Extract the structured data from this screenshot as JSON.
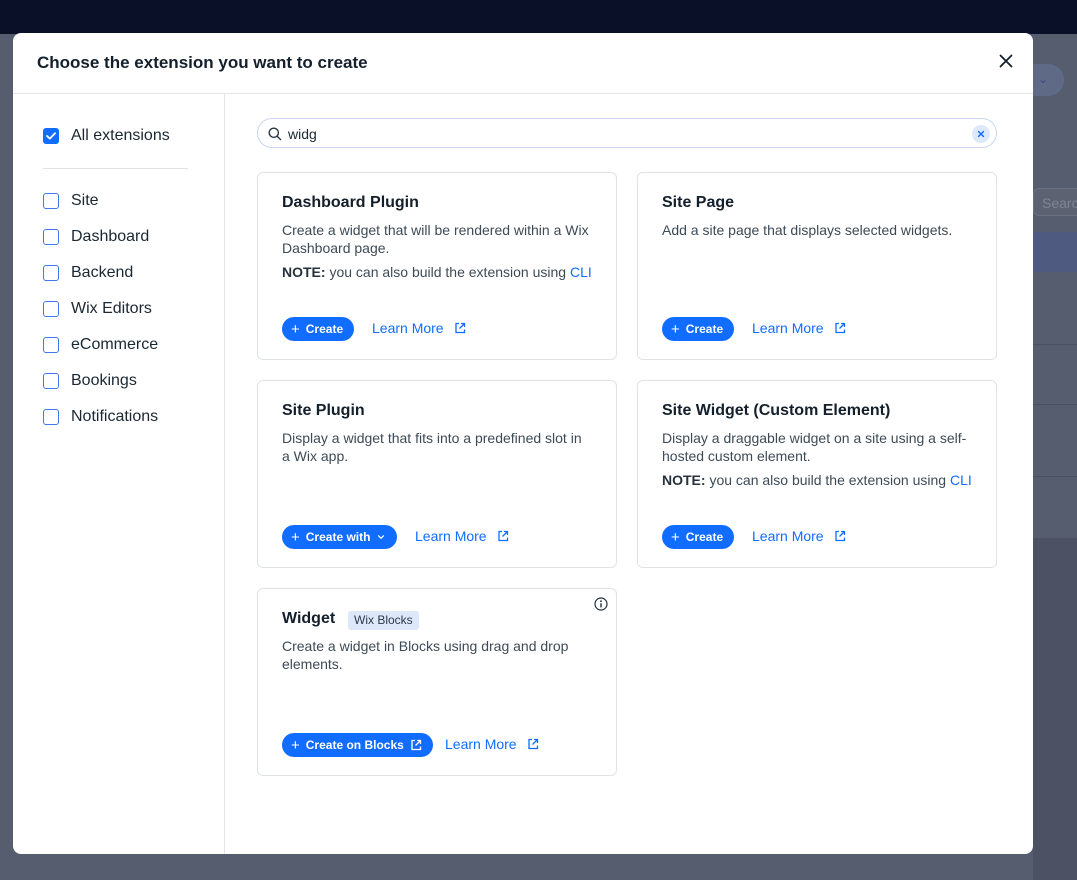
{
  "modal": {
    "title": "Choose the extension you want to create"
  },
  "filters": {
    "all": {
      "label": "All extensions",
      "checked": true
    },
    "items": [
      {
        "label": "Site",
        "checked": false
      },
      {
        "label": "Dashboard",
        "checked": false
      },
      {
        "label": "Backend",
        "checked": false
      },
      {
        "label": "Wix Editors",
        "checked": false
      },
      {
        "label": "eCommerce",
        "checked": false
      },
      {
        "label": "Bookings",
        "checked": false
      },
      {
        "label": "Notifications",
        "checked": false
      }
    ]
  },
  "search": {
    "value": "widg"
  },
  "background": {
    "search_placeholder": "Searc"
  },
  "cards": [
    {
      "title": "Dashboard Plugin",
      "description": "Create a widget that will be rendered within a Wix Dashboard page.",
      "note_label": "NOTE:",
      "note_text": " you can also build the extension using ",
      "note_link": "CLI",
      "button": "Create",
      "learn_more": "Learn More"
    },
    {
      "title": "Site Page",
      "description": "Add a site page that displays selected widgets.",
      "button": "Create",
      "learn_more": "Learn More"
    },
    {
      "title": "Site Plugin",
      "description": "Display a widget that fits into a predefined slot in a Wix app.",
      "button": "Create with",
      "learn_more": "Learn More"
    },
    {
      "title": "Site Widget (Custom Element)",
      "description": "Display a draggable widget on a site using a self-hosted custom element.",
      "note_label": "NOTE:",
      "note_text": " you can also build the extension using ",
      "note_link": "CLI",
      "button": "Create",
      "learn_more": "Learn More"
    },
    {
      "title": "Widget",
      "badge": "Wix Blocks",
      "description": "Create a widget in Blocks using drag and drop elements.",
      "button": "Create on Blocks",
      "learn_more": "Learn More"
    }
  ],
  "icons": {
    "close": "close-icon",
    "search": "search-icon",
    "clear": "clear-icon",
    "external": "external-link-icon",
    "info": "info-icon",
    "chevron": "chevron-down-icon",
    "check": "checkmark-icon"
  },
  "colors": {
    "accent": "#116dff",
    "overlay": "#4e5566",
    "topbar": "#0a1028"
  }
}
